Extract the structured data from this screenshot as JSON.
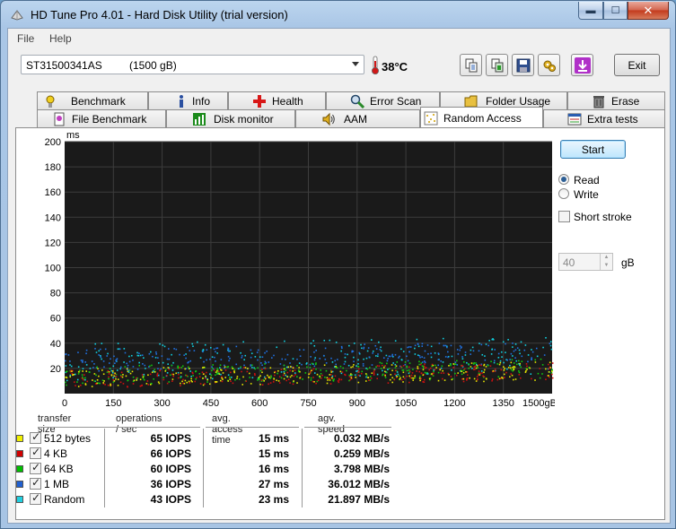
{
  "window": {
    "title": "HD Tune Pro 4.01 - Hard Disk Utility (trial version)"
  },
  "caption_buttons": {
    "minimize": "▬",
    "maximize": "☐",
    "close": "✕"
  },
  "menu": {
    "file": "File",
    "help": "Help"
  },
  "drive": {
    "name": "ST31500341AS",
    "size": "(1500 gB)",
    "temperature": "38°C"
  },
  "toolbar": {
    "exit_label": "Exit",
    "icons": [
      "copy-text-icon",
      "copy-screenshot-icon",
      "save-icon",
      "options-icon",
      "download-icon"
    ]
  },
  "tabs_row1": [
    {
      "label": "Benchmark",
      "icon": "benchmark-icon"
    },
    {
      "label": "Info",
      "icon": "info-icon"
    },
    {
      "label": "Health",
      "icon": "health-icon"
    },
    {
      "label": "Error Scan",
      "icon": "error-scan-icon"
    },
    {
      "label": "Folder Usage",
      "icon": "folder-icon"
    },
    {
      "label": "Erase",
      "icon": "erase-icon"
    }
  ],
  "tabs_row2": [
    {
      "label": "File Benchmark",
      "icon": "file-benchmark-icon"
    },
    {
      "label": "Disk monitor",
      "icon": "disk-monitor-icon"
    },
    {
      "label": "AAM",
      "icon": "speaker-icon"
    },
    {
      "label": "Random Access",
      "icon": "random-access-icon",
      "active": true
    },
    {
      "label": "Extra tests",
      "icon": "extra-tests-icon"
    }
  ],
  "controls": {
    "start_label": "Start",
    "read_label": "Read",
    "write_label": "Write",
    "mode_selected": "Read",
    "short_stroke_label": "Short stroke",
    "short_stroke_checked": false,
    "short_stroke_value": "40",
    "short_stroke_unit": "gB"
  },
  "chart_data": {
    "type": "scatter",
    "ylabel": "ms",
    "xlabel": "gB",
    "xlim": [
      0,
      1500
    ],
    "ylim": [
      0,
      200
    ],
    "x_ticks": [
      "0",
      "150",
      "300",
      "450",
      "600",
      "750",
      "900",
      "1050",
      "1200",
      "1350",
      "1500gB"
    ],
    "y_ticks": [
      "200",
      "180",
      "160",
      "140",
      "120",
      "100",
      "80",
      "60",
      "40",
      "20"
    ],
    "grid": true,
    "background": "#1a1a1a",
    "series": [
      {
        "name": "512 bytes",
        "color": "#e8e800",
        "ms_range": [
          5,
          20
        ]
      },
      {
        "name": "4 KB",
        "color": "#d01010",
        "ms_range": [
          5,
          20
        ]
      },
      {
        "name": "64 KB",
        "color": "#10c810",
        "ms_range": [
          7,
          22
        ]
      },
      {
        "name": "1 MB",
        "color": "#2070e0",
        "ms_range": [
          18,
          36
        ]
      },
      {
        "name": "Random",
        "color": "#10d0e0",
        "ms_range": [
          10,
          40
        ]
      }
    ]
  },
  "results": {
    "headers": [
      "transfer size",
      "operations / sec",
      "avg. access time",
      "agv. speed"
    ],
    "rows": [
      {
        "name": "512 bytes",
        "color": "#f0f000",
        "ops": "65 IOPS",
        "access": "15 ms",
        "speed": "0.032 MB/s"
      },
      {
        "name": "4 KB",
        "color": "#d00000",
        "ops": "66 IOPS",
        "access": "15 ms",
        "speed": "0.259 MB/s"
      },
      {
        "name": "64 KB",
        "color": "#00c000",
        "ops": "60 IOPS",
        "access": "16 ms",
        "speed": "3.798 MB/s"
      },
      {
        "name": "1 MB",
        "color": "#2060d0",
        "ops": "36 IOPS",
        "access": "27 ms",
        "speed": "36.012 MB/s"
      },
      {
        "name": "Random",
        "color": "#20d0e0",
        "ops": "43 IOPS",
        "access": "23 ms",
        "speed": "21.897 MB/s"
      }
    ]
  }
}
